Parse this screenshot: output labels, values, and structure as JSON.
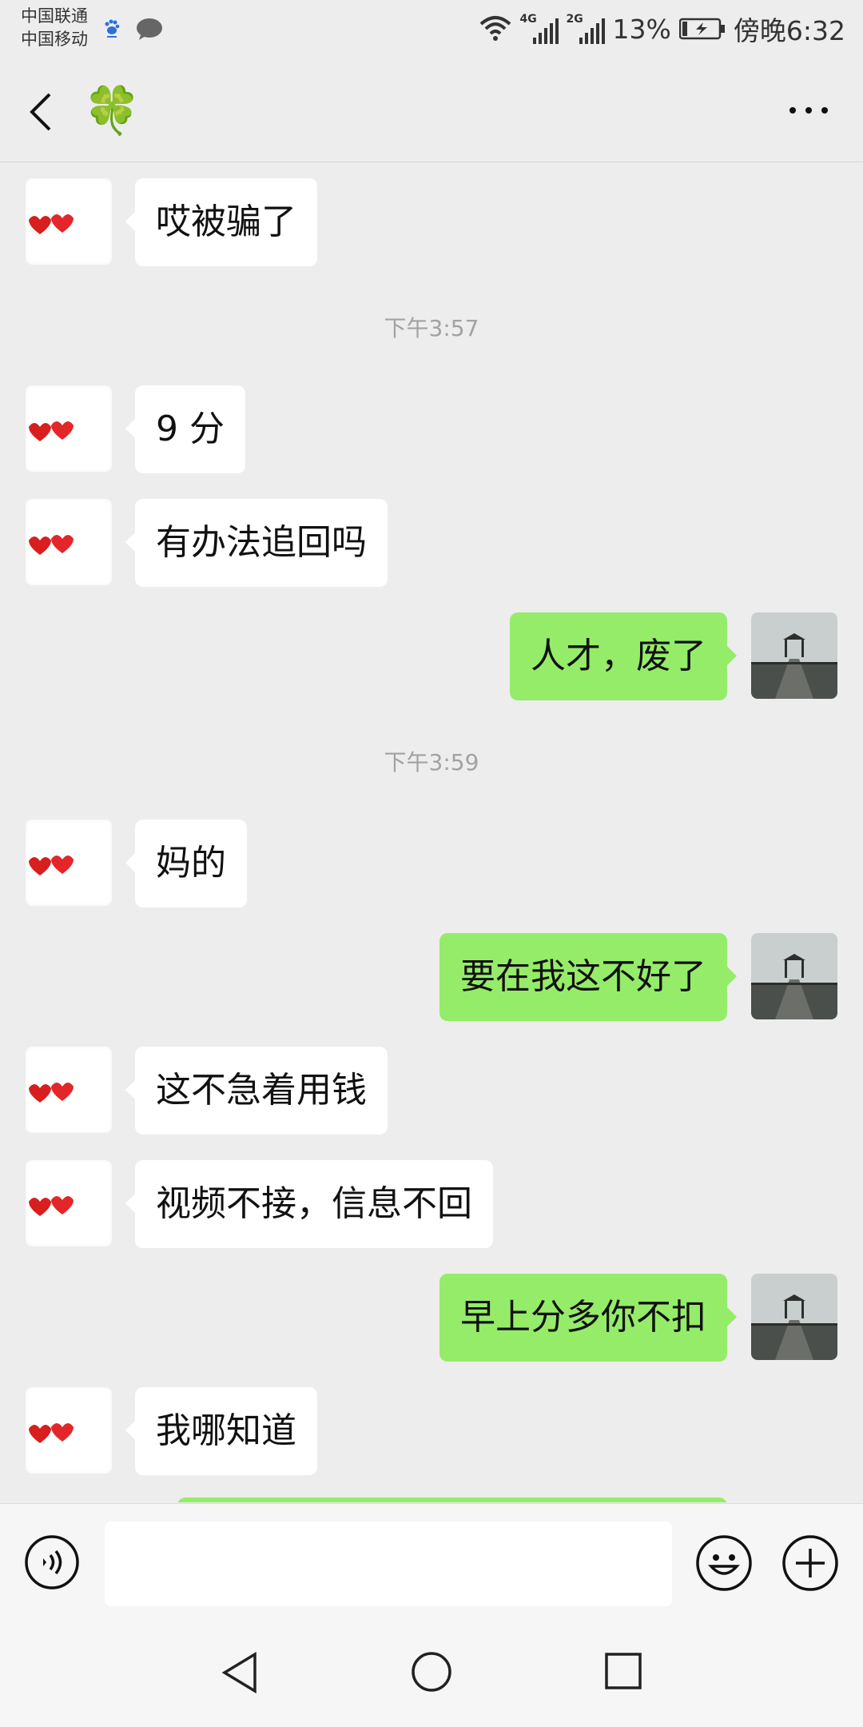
{
  "status_bar": {
    "carrier_1": "中国联通",
    "carrier_2": "中国移动",
    "network_a": "4G",
    "network_b": "2G",
    "battery": "13%",
    "time": "傍晚6:32"
  },
  "header": {
    "title": "🍀"
  },
  "messages": [
    {
      "side": "in",
      "text": "哎被骗了"
    },
    {
      "type": "time",
      "text": "下午3:57"
    },
    {
      "side": "in",
      "text": "9 分"
    },
    {
      "side": "in",
      "text": "有办法追回吗"
    },
    {
      "side": "out",
      "text": "人才，废了"
    },
    {
      "type": "time",
      "text": "下午3:59"
    },
    {
      "side": "in",
      "text": "妈的"
    },
    {
      "side": "out",
      "text": "要在我这不好了"
    },
    {
      "side": "in",
      "text": "这不急着用钱"
    },
    {
      "side": "in",
      "text": "视频不接，信息不回"
    },
    {
      "side": "out",
      "text": "早上分多你不扣"
    },
    {
      "side": "in",
      "text": "我哪知道"
    }
  ],
  "input": {
    "value": "",
    "placeholder": ""
  },
  "colors": {
    "background": "#ededed",
    "incoming_bubble": "#ffffff",
    "outgoing_bubble": "#95ec69"
  }
}
